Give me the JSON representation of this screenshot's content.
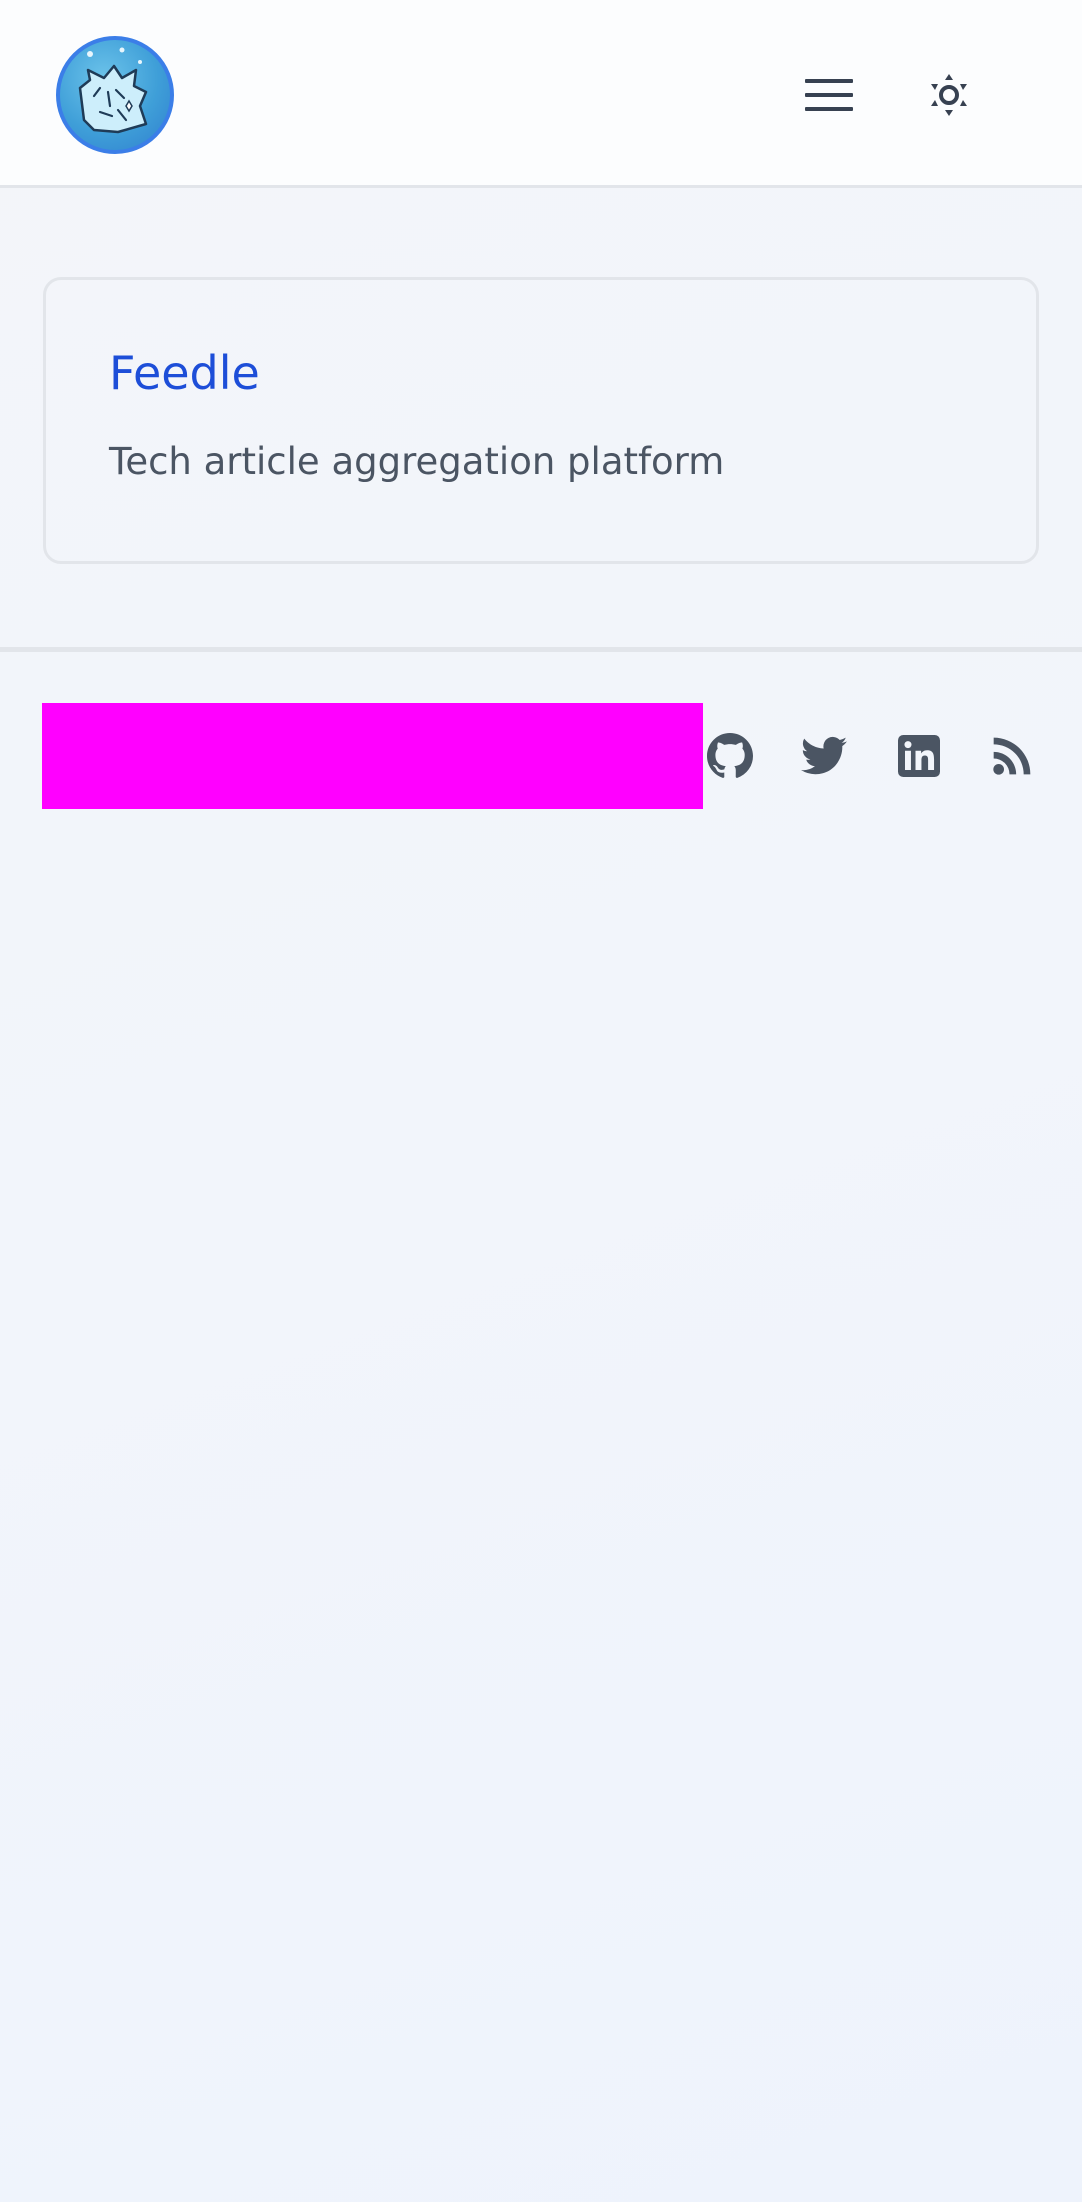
{
  "header": {
    "avatar_icon": "anime-avatar-icon",
    "menu_icon": "hamburger-menu-icon",
    "theme_icon": "sun-brightness-icon"
  },
  "card": {
    "title": "Feedle",
    "description": "Tech article aggregation platform"
  },
  "footer": {
    "social_links": [
      {
        "icon": "github-icon"
      },
      {
        "icon": "twitter-icon"
      },
      {
        "icon": "linkedin-icon"
      },
      {
        "icon": "rss-icon"
      }
    ]
  },
  "colors": {
    "link": "#1d4ed8",
    "text_muted": "#4b5563",
    "icon": "#4b5563",
    "avatar_border": "#3b7ee8",
    "redaction": "#ff00ff"
  }
}
